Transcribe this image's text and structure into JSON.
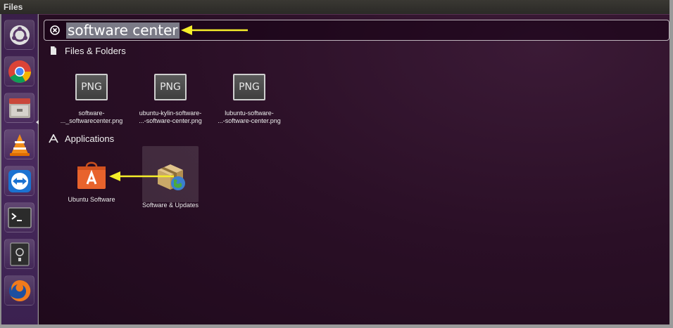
{
  "top_panel": {
    "title": "Files"
  },
  "launcher": {
    "items": [
      {
        "name": "ubuntu-dash-icon"
      },
      {
        "name": "chrome-icon"
      },
      {
        "name": "files-icon"
      },
      {
        "name": "vlc-icon"
      },
      {
        "name": "teamviewer-icon"
      },
      {
        "name": "terminal-icon"
      },
      {
        "name": "disk-icon"
      },
      {
        "name": "firefox-icon"
      }
    ]
  },
  "search": {
    "query": "software center"
  },
  "sections": {
    "files": {
      "title": "Files & Folders",
      "items": [
        {
          "thumb": "PNG",
          "line1": "software-",
          "line2": "..._softwarecenter.png"
        },
        {
          "thumb": "PNG",
          "line1": "ubuntu-kylin-software-",
          "line2": "...-software-center.png"
        },
        {
          "thumb": "PNG",
          "line1": "lubuntu-software-",
          "line2": "...-software-center.png"
        }
      ]
    },
    "applications": {
      "title": "Applications",
      "items": [
        {
          "label": "Ubuntu Software"
        },
        {
          "label": "Software & Updates"
        }
      ]
    }
  },
  "colors": {
    "arrow": "#f5ee2a",
    "software_orange": "#e8632c"
  }
}
